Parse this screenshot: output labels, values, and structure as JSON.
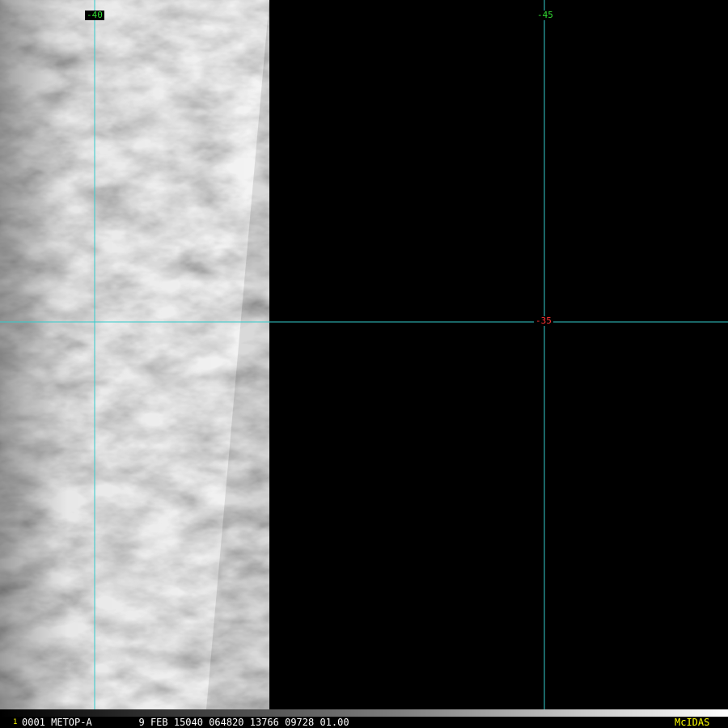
{
  "map": {
    "graticule_color": "#33cccc",
    "graticule": {
      "meridians": [
        {
          "label": "-40",
          "color": "#33dd33"
        },
        {
          "label": "-45",
          "color": "#33dd33"
        }
      ],
      "parallels": [
        {
          "label": "-35",
          "color": "#ff3333"
        }
      ]
    },
    "imagery": {
      "content": "grayscale satellite cloud field on the left portion of the frame; remainder no data (black)",
      "no_data_color": "#000000"
    }
  },
  "status_bar": {
    "frame_number": "1",
    "frame_number_color": "#ffff00",
    "text": "0001 METOP-A        9 FEB 15040 064820 13766 09728 01.00",
    "brand": "McIDAS",
    "brand_color": "#ffff00"
  }
}
